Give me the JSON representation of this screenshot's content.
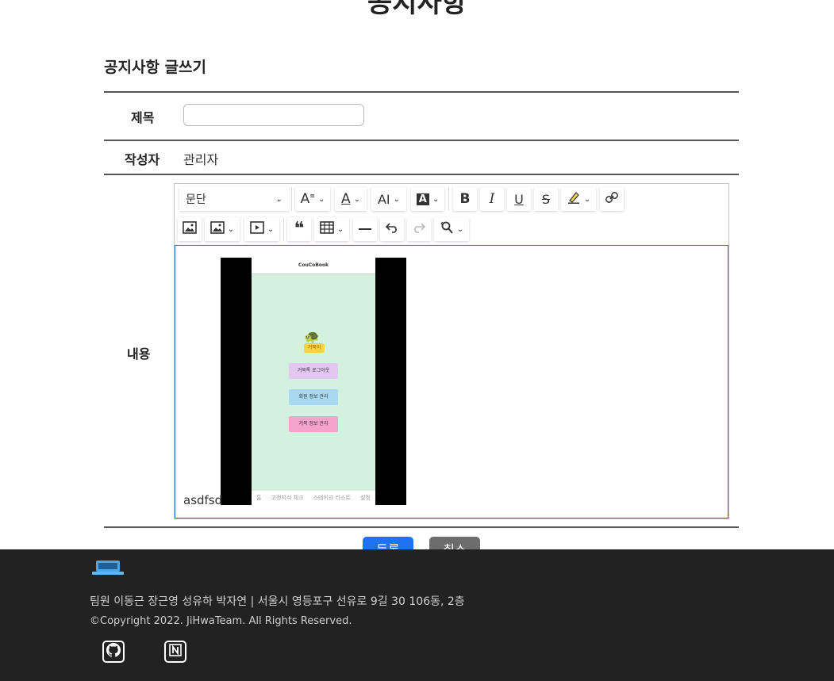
{
  "page": {
    "title": "공지사항",
    "subtitle": "공지사항 글쓰기"
  },
  "form": {
    "title_label": "제목",
    "title_value": "",
    "writer_label": "작성자",
    "writer_value": "관리자",
    "content_label": "내용",
    "content_text": "asdfsd"
  },
  "editor": {
    "heading_select": "문단",
    "toolbar_row1": [
      "font-size-icon",
      "font-color-icon",
      "font-family-icon",
      "background-color-icon",
      "bold-icon",
      "italic-icon",
      "underline-icon",
      "strikethrough-icon",
      "highlight-icon",
      "link-icon"
    ],
    "toolbar_row2": [
      "image-upload-icon",
      "image-insert-icon",
      "media-embed-icon",
      "blockquote-icon",
      "table-icon",
      "horizontal-line-icon",
      "undo-icon",
      "redo-icon",
      "find-replace-icon"
    ],
    "embedded_image": {
      "app_title": "CouCoBook",
      "logo_text": "거북이",
      "buttons": [
        {
          "label": "거북톡 로그아웃",
          "color": "#e4c6f2"
        },
        {
          "label": "회원 정보 관리",
          "color": "#a9d8f2"
        },
        {
          "label": "거북 정보 관리",
          "color": "#f5a2cc"
        }
      ],
      "bottom_nav": [
        "홈",
        "고정지식 체크",
        "스테이크 리스트",
        "설정"
      ]
    }
  },
  "actions": {
    "submit_label": "등록",
    "cancel_label": "취소"
  },
  "footer": {
    "team": "팀원 이동근 장근영 성유하 박자연 | 서울시 영등포구 선유로 9길 30 106동, 2층",
    "copyright": "©Copyright 2022. JiHwaTeam. All Rights Reserved.",
    "icons": [
      "github-icon",
      "notion-icon"
    ]
  },
  "colors": {
    "primary": "#1f72f2",
    "secondary": "#6c6c6c",
    "footer_bg": "#222222",
    "focus_border": "#2f6fd6"
  }
}
